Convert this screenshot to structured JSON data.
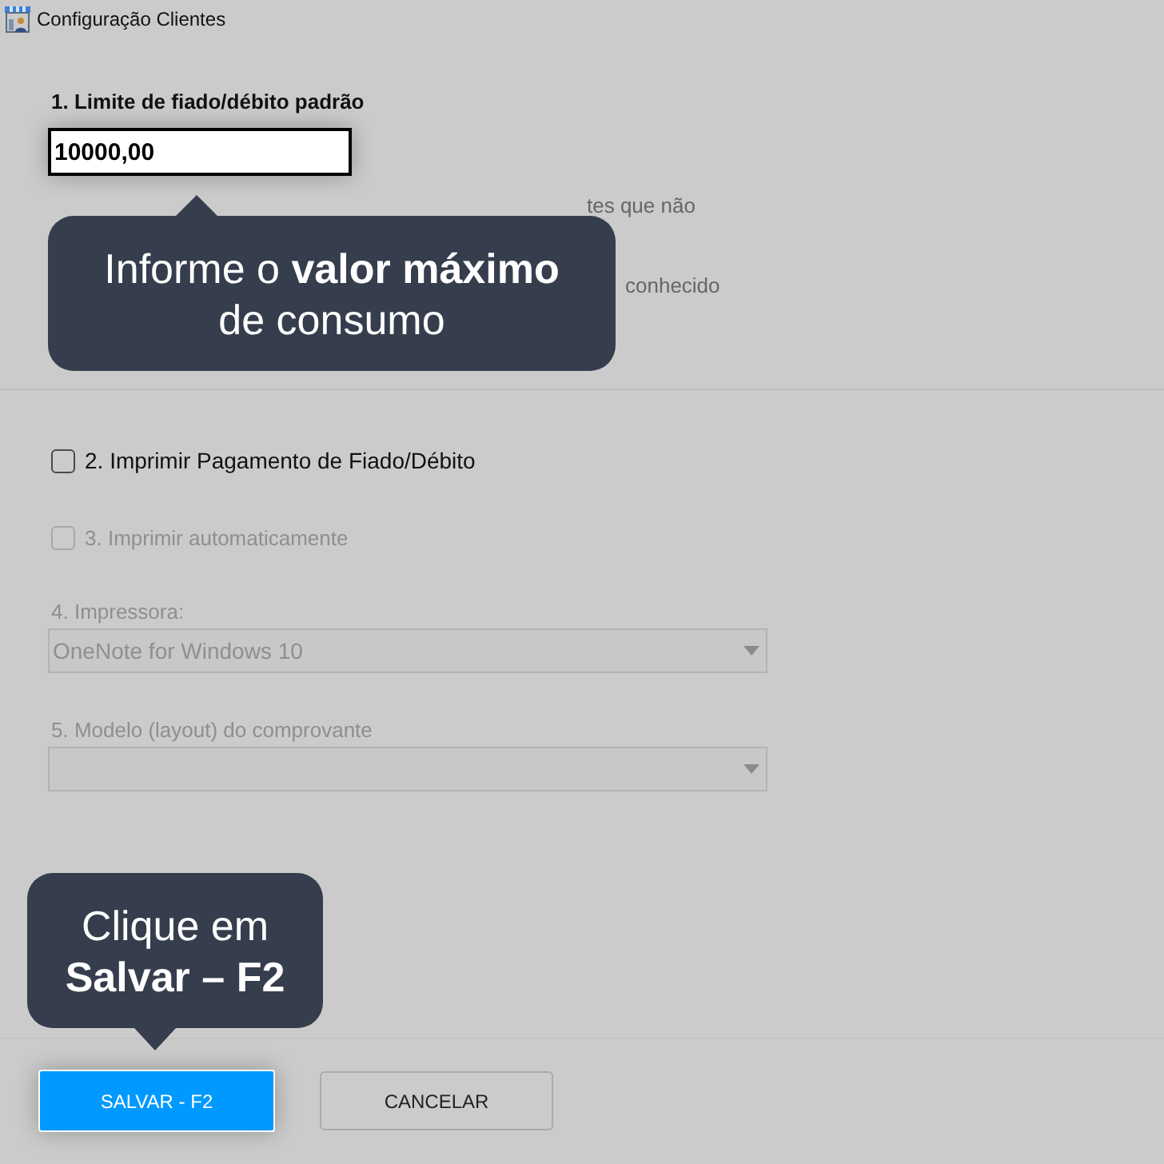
{
  "window": {
    "title": "Configuração Clientes"
  },
  "limit": {
    "label": "1. Limite de fiado/débito padrão",
    "value": "10000,00",
    "description_visible": [
      "tes que não",
      "conhecido"
    ],
    "tooltip": {
      "lines": [
        "Informe o **valor máximo**",
        "de consumo"
      ]
    }
  },
  "options": [
    {
      "kind": "checkbox",
      "label": "2. Imprimir Pagamento de Fiado/Débito",
      "checked": false,
      "disabled": false
    },
    {
      "kind": "checkbox",
      "label": "3. Imprimir automaticamente",
      "checked": false,
      "disabled": true
    },
    {
      "kind": "select",
      "label": "4. Impressora:",
      "value": "OneNote for Windows 10",
      "disabled": true
    },
    {
      "kind": "select",
      "label": "5. Modelo (layout) do comprovante",
      "disabled": true
    }
  ],
  "buttons": [
    {
      "kind": "primary",
      "label": "SALVAR - F2",
      "tooltip": {
        "lines": [
          "Clique em",
          "**Salvar – F2**"
        ]
      }
    },
    {
      "kind": "secondary",
      "label": "CANCELAR"
    }
  ]
}
